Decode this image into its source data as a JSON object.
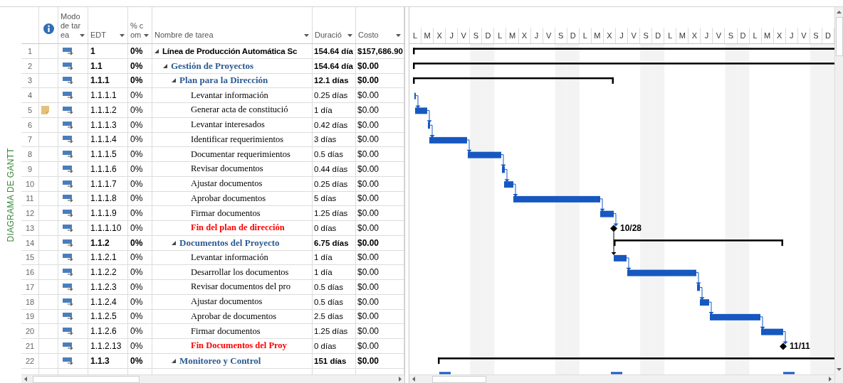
{
  "side_label": "DIAGRAMA DE GANTT",
  "columns": {
    "mode": "Modo de tarea",
    "edt": "EDT",
    "pct": "% com",
    "name": "Nombre de tarea",
    "duration": "Duració",
    "cost": "Costo"
  },
  "timescale": [
    "L",
    "M",
    "X",
    "J",
    "V",
    "S",
    "D",
    "L",
    "M",
    "X",
    "J",
    "V",
    "S",
    "D",
    "L",
    "M",
    "X",
    "J",
    "V",
    "S",
    "D",
    "L",
    "M",
    "X",
    "J",
    "V",
    "S",
    "D",
    "L",
    "M",
    "X",
    "J",
    "V",
    "S",
    "D"
  ],
  "tasks": [
    {
      "id": "1",
      "kind": "summary",
      "expanded": true,
      "note": false,
      "edt": "1",
      "pct": "0%",
      "name": "Línea de Producción Automática Sc",
      "duration": "154.64 día",
      "cost": "$157,686.90",
      "children": [
        {
          "id": "2",
          "kind": "summary",
          "expanded": true,
          "note": false,
          "edt": "1.1",
          "pct": "0%",
          "name": "Gestión de Proyectos",
          "duration": "154.64 día",
          "cost": "$0.00",
          "children": [
            {
              "id": "3",
              "kind": "summary",
              "expanded": true,
              "note": false,
              "edt": "1.1.1",
              "pct": "0%",
              "name": "Plan para la Dirección",
              "duration": "12.1 días",
              "cost": "$0.00",
              "children": [
                {
                  "id": "4",
                  "kind": "task",
                  "note": false,
                  "edt": "1.1.1.1",
                  "pct": "0%",
                  "name": "Levantar información",
                  "duration": "0.25 días",
                  "cost": "$0.00"
                },
                {
                  "id": "5",
                  "kind": "task",
                  "note": true,
                  "edt": "1.1.1.2",
                  "pct": "0%",
                  "name": "Generar acta de constitució",
                  "duration": "1 día",
                  "cost": "$0.00"
                },
                {
                  "id": "6",
                  "kind": "task",
                  "note": false,
                  "edt": "1.1.1.3",
                  "pct": "0%",
                  "name": "Levantar interesados",
                  "duration": "0.42 días",
                  "cost": "$0.00"
                },
                {
                  "id": "7",
                  "kind": "task",
                  "note": false,
                  "edt": "1.1.1.4",
                  "pct": "0%",
                  "name": "Identificar requerimientos",
                  "duration": "3 días",
                  "cost": "$0.00"
                },
                {
                  "id": "8",
                  "kind": "task",
                  "note": false,
                  "edt": "1.1.1.5",
                  "pct": "0%",
                  "name": "Documentar requerimientos",
                  "duration": "0.5 días",
                  "cost": "$0.00"
                },
                {
                  "id": "9",
                  "kind": "task",
                  "note": false,
                  "edt": "1.1.1.6",
                  "pct": "0%",
                  "name": "Revisar documentos",
                  "duration": "0.44 días",
                  "cost": "$0.00"
                },
                {
                  "id": "10",
                  "kind": "task",
                  "note": false,
                  "edt": "1.1.1.7",
                  "pct": "0%",
                  "name": "Ajustar documentos",
                  "duration": "0.25 días",
                  "cost": "$0.00"
                },
                {
                  "id": "11",
                  "kind": "task",
                  "note": false,
                  "edt": "1.1.1.8",
                  "pct": "0%",
                  "name": "Aprobar documentos",
                  "duration": "5 días",
                  "cost": "$0.00"
                },
                {
                  "id": "12",
                  "kind": "task",
                  "note": false,
                  "edt": "1.1.1.9",
                  "pct": "0%",
                  "name": "Firmar documentos",
                  "duration": "1.25 días",
                  "cost": "$0.00"
                },
                {
                  "id": "13",
                  "kind": "milestone",
                  "note": false,
                  "edt": "1.1.1.10",
                  "pct": "0%",
                  "name": "Fin del plan de dirección",
                  "duration": "0 días",
                  "cost": "$0.00",
                  "gantt_label": "10/28"
                }
              ]
            },
            {
              "id": "14",
              "kind": "summary",
              "expanded": true,
              "note": false,
              "edt": "1.1.2",
              "pct": "0%",
              "name": "Documentos del Proyecto",
              "duration": "6.75 días",
              "cost": "$0.00",
              "children": [
                {
                  "id": "15",
                  "kind": "task",
                  "note": false,
                  "edt": "1.1.2.1",
                  "pct": "0%",
                  "name": "Levantar información",
                  "duration": "1 día",
                  "cost": "$0.00"
                },
                {
                  "id": "16",
                  "kind": "task",
                  "note": false,
                  "edt": "1.1.2.2",
                  "pct": "0%",
                  "name": "Desarrollar los documentos",
                  "duration": "1 día",
                  "cost": "$0.00"
                },
                {
                  "id": "17",
                  "kind": "task",
                  "note": false,
                  "edt": "1.1.2.3",
                  "pct": "0%",
                  "name": "Revisar documentos del pro",
                  "duration": "0.5 días",
                  "cost": "$0.00"
                },
                {
                  "id": "18",
                  "kind": "task",
                  "note": false,
                  "edt": "1.1.2.4",
                  "pct": "0%",
                  "name": "Ajustar documentos",
                  "duration": "0.5 días",
                  "cost": "$0.00"
                },
                {
                  "id": "19",
                  "kind": "task",
                  "note": false,
                  "edt": "1.1.2.5",
                  "pct": "0%",
                  "name": "Aprobar de documentos",
                  "duration": "2.5 días",
                  "cost": "$0.00"
                },
                {
                  "id": "20",
                  "kind": "task",
                  "note": false,
                  "edt": "1.1.2.6",
                  "pct": "0%",
                  "name": "Firmar documentos",
                  "duration": "1.25 días",
                  "cost": "$0.00"
                },
                {
                  "id": "21",
                  "kind": "milestone",
                  "note": false,
                  "edt": "1.1.2.13",
                  "pct": "0%",
                  "name": "Fin Documentos del Proy",
                  "duration": "0 días",
                  "cost": "$0.00",
                  "gantt_label": "11/11"
                }
              ]
            },
            {
              "id": "22",
              "kind": "summary",
              "expanded": true,
              "note": false,
              "edt": "1.1.3",
              "pct": "0%",
              "name": "Monitoreo y Control",
              "duration": "151 días",
              "cost": "$0.00"
            }
          ]
        }
      ]
    }
  ]
}
